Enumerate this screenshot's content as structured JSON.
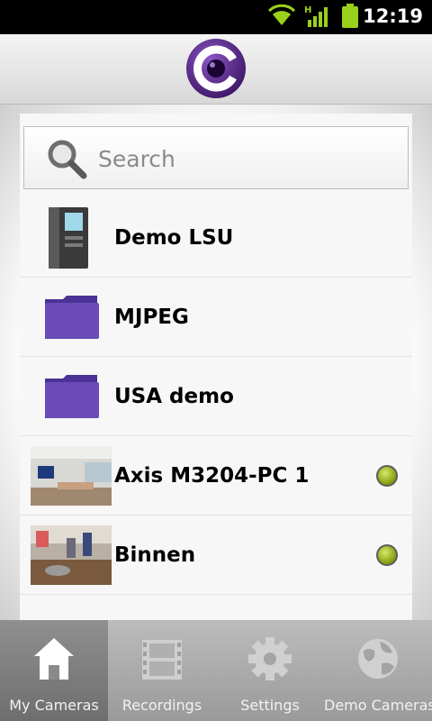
{
  "status_bar": {
    "time": "12:19",
    "icons": [
      "wifi-icon",
      "signal-icon",
      "battery-icon"
    ],
    "network_type": "H"
  },
  "header": {
    "logo_icon": "camera-app-logo",
    "brand_color": "#5b2a8a"
  },
  "search": {
    "placeholder": "Search",
    "value": ""
  },
  "camera_list": [
    {
      "label": "Demo LSU",
      "icon": "server-icon"
    },
    {
      "label": "MJPEG",
      "icon": "folder-icon"
    },
    {
      "label": "USA demo",
      "icon": "folder-icon"
    },
    {
      "label": "Axis M3204-PC 1",
      "icon": "camera-thumbnail",
      "status": "online"
    },
    {
      "label": "Binnen",
      "icon": "camera-thumbnail",
      "status": "online"
    }
  ],
  "tabs": [
    {
      "label": "My Cameras",
      "icon": "home-icon",
      "active": true
    },
    {
      "label": "Recordings",
      "icon": "film-icon",
      "active": false
    },
    {
      "label": "Settings",
      "icon": "gear-icon",
      "active": false
    },
    {
      "label": "Demo Cameras",
      "icon": "globe-icon",
      "active": false
    }
  ],
  "colors": {
    "folder": "#6a4bb8",
    "status_online": "#9bb51f"
  }
}
